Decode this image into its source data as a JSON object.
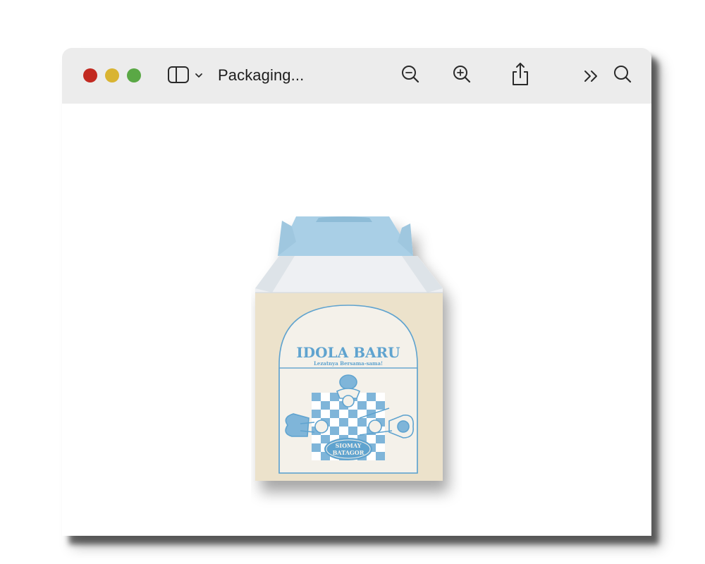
{
  "window": {
    "title": "Packaging...",
    "traffic_lights": [
      {
        "name": "close",
        "color": "#c22a21"
      },
      {
        "name": "minimize",
        "color": "#d9b432"
      },
      {
        "name": "zoom",
        "color": "#5aa845"
      }
    ]
  },
  "toolbar": {
    "sidebar_toggle_icon": "sidebar-icon",
    "sidebar_menu_icon": "chevron-down-icon",
    "zoom_out_icon": "zoom-out-icon",
    "zoom_in_icon": "zoom-in-icon",
    "share_icon": "share-icon",
    "more_icon": "chevron-double-right-icon",
    "search_icon": "search-icon"
  },
  "document": {
    "brand": "IDOLA BARU",
    "tagline": "Lezatnya Bersama-sama!",
    "product_line1": "SIOMAY",
    "product_line2": "BATAGOR",
    "colors": {
      "print_blue": "#5fa3cf",
      "kraft": "#ece2cb",
      "box_white": "#f3f4f6",
      "inner_blue": "#a9cfe6"
    }
  }
}
